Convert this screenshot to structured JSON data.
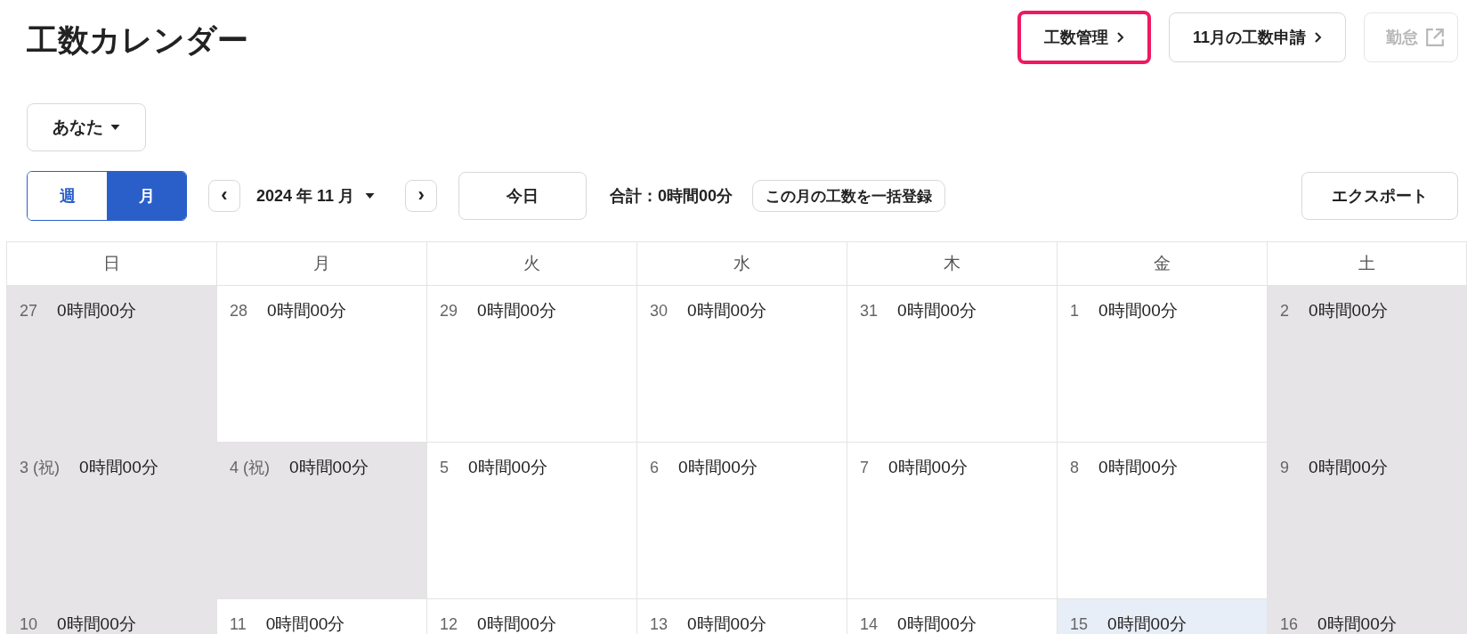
{
  "page_title": "工数カレンダー",
  "header_buttons": [
    {
      "kind": "link",
      "label": "工数管理",
      "highlighted": true,
      "disabled": false
    },
    {
      "kind": "link",
      "label": "11月の工数申請",
      "highlighted": false,
      "disabled": false
    },
    {
      "kind": "external",
      "label": "勤怠",
      "highlighted": false,
      "disabled": true
    }
  ],
  "person_select": {
    "value": "あなた"
  },
  "view_toggle": [
    {
      "label": "週",
      "selected": false
    },
    {
      "label": "月",
      "selected": true
    }
  ],
  "month_picker": {
    "prev": "‹",
    "value": "2024 年 11 月",
    "next": "›"
  },
  "today_button": "今日",
  "total": "合計：0時間00分",
  "bulk_button": "この月の工数を一括登録",
  "export_button": "エクスポート",
  "calendar": {
    "weekdays": [
      "日",
      "月",
      "火",
      "水",
      "木",
      "金",
      "土"
    ],
    "weeks": [
      [
        {
          "date": "27",
          "hours": "0時間00分",
          "off_day": true,
          "today": false
        },
        {
          "date": "28",
          "hours": "0時間00分",
          "off_day": false,
          "today": false
        },
        {
          "date": "29",
          "hours": "0時間00分",
          "off_day": false,
          "today": false
        },
        {
          "date": "30",
          "hours": "0時間00分",
          "off_day": false,
          "today": false
        },
        {
          "date": "31",
          "hours": "0時間00分",
          "off_day": false,
          "today": false
        },
        {
          "date": "1",
          "hours": "0時間00分",
          "off_day": false,
          "today": false
        },
        {
          "date": "2",
          "hours": "0時間00分",
          "off_day": true,
          "today": false
        }
      ],
      [
        {
          "date": "3 (祝)",
          "hours": "0時間00分",
          "off_day": true,
          "today": false
        },
        {
          "date": "4 (祝)",
          "hours": "0時間00分",
          "off_day": true,
          "today": false
        },
        {
          "date": "5",
          "hours": "0時間00分",
          "off_day": false,
          "today": false
        },
        {
          "date": "6",
          "hours": "0時間00分",
          "off_day": false,
          "today": false
        },
        {
          "date": "7",
          "hours": "0時間00分",
          "off_day": false,
          "today": false
        },
        {
          "date": "8",
          "hours": "0時間00分",
          "off_day": false,
          "today": false
        },
        {
          "date": "9",
          "hours": "0時間00分",
          "off_day": true,
          "today": false
        }
      ],
      [
        {
          "date": "10",
          "hours": "0時間00分",
          "off_day": true,
          "today": false
        },
        {
          "date": "11",
          "hours": "0時間00分",
          "off_day": false,
          "today": false
        },
        {
          "date": "12",
          "hours": "0時間00分",
          "off_day": false,
          "today": false
        },
        {
          "date": "13",
          "hours": "0時間00分",
          "off_day": false,
          "today": false
        },
        {
          "date": "14",
          "hours": "0時間00分",
          "off_day": false,
          "today": false
        },
        {
          "date": "15",
          "hours": "0時間00分",
          "off_day": false,
          "today": true
        },
        {
          "date": "16",
          "hours": "0時間00分",
          "off_day": true,
          "today": false
        }
      ]
    ]
  }
}
